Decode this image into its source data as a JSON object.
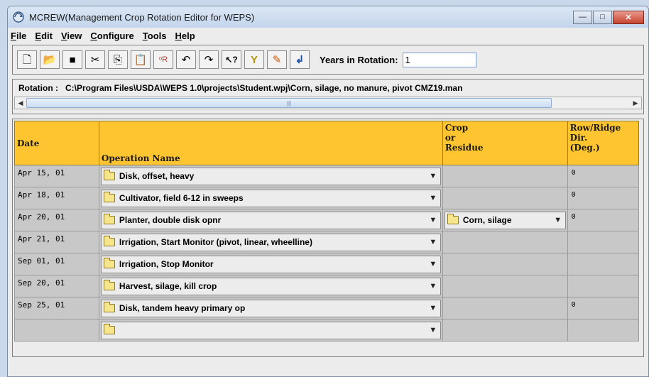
{
  "window": {
    "title": "MCREW(Management Crop Rotation Editor for WEPS)",
    "controls": {
      "minimize": "—",
      "maximize": "□",
      "close": "✕"
    }
  },
  "menu": [
    "File",
    "Edit",
    "View",
    "Configure",
    "Tools",
    "Help"
  ],
  "toolbar": {
    "buttons": [
      {
        "icon": "new-file-icon",
        "glyph": "🗋"
      },
      {
        "icon": "open-folder-icon",
        "glyph": "📂"
      },
      {
        "icon": "save-icon",
        "glyph": "■"
      },
      {
        "icon": "cut-icon",
        "glyph": "✂"
      },
      {
        "icon": "copy-icon",
        "glyph": "⎘"
      },
      {
        "icon": "paste-icon",
        "glyph": "📋"
      },
      {
        "icon": "sort-icon",
        "glyph": "ᵒR"
      },
      {
        "icon": "undo-icon",
        "glyph": "↶"
      },
      {
        "icon": "redo-icon",
        "glyph": "↷"
      },
      {
        "icon": "help-pointer-icon",
        "glyph": "↖?"
      },
      {
        "icon": "filter-icon",
        "glyph": "Y"
      },
      {
        "icon": "edit-pencil-icon",
        "glyph": "✎"
      },
      {
        "icon": "enter-arrow-icon",
        "glyph": "↲"
      }
    ],
    "years_label": "Years in Rotation:",
    "years_value": "1"
  },
  "rotation": {
    "label": "Rotation :",
    "path": "C:\\Program Files\\USDA\\WEPS 1.0\\projects\\Student.wpj\\Corn, silage, no manure, pivot CMZ19.man"
  },
  "grid": {
    "headers": {
      "date": "Date",
      "operation": "Operation Name",
      "crop": [
        "Crop",
        "or",
        "Residue"
      ],
      "dir": [
        "Row/Ridge",
        "Dir.",
        "(Deg.)"
      ]
    },
    "rows": [
      {
        "date": "Apr 15, 01",
        "operation": "Disk, offset, heavy",
        "crop": "",
        "dir": "0"
      },
      {
        "date": "Apr 18, 01",
        "operation": "Cultivator, field 6-12 in sweeps",
        "crop": "",
        "dir": "0"
      },
      {
        "date": "Apr 20, 01",
        "operation": "Planter, double disk opnr",
        "crop": "Corn, silage",
        "dir": "0"
      },
      {
        "date": "Apr 21, 01",
        "operation": "Irrigation, Start Monitor (pivot, linear, wheelline)",
        "crop": "",
        "dir": ""
      },
      {
        "date": "Sep 01, 01",
        "operation": "Irrigation, Stop Monitor",
        "crop": "",
        "dir": ""
      },
      {
        "date": "Sep 20, 01",
        "operation": "Harvest, silage, kill crop",
        "crop": "",
        "dir": ""
      },
      {
        "date": "Sep 25, 01",
        "operation": "Disk, tandem heavy primary op",
        "crop": "",
        "dir": "0"
      },
      {
        "date": "",
        "operation": "",
        "crop": "",
        "dir": ""
      }
    ]
  }
}
